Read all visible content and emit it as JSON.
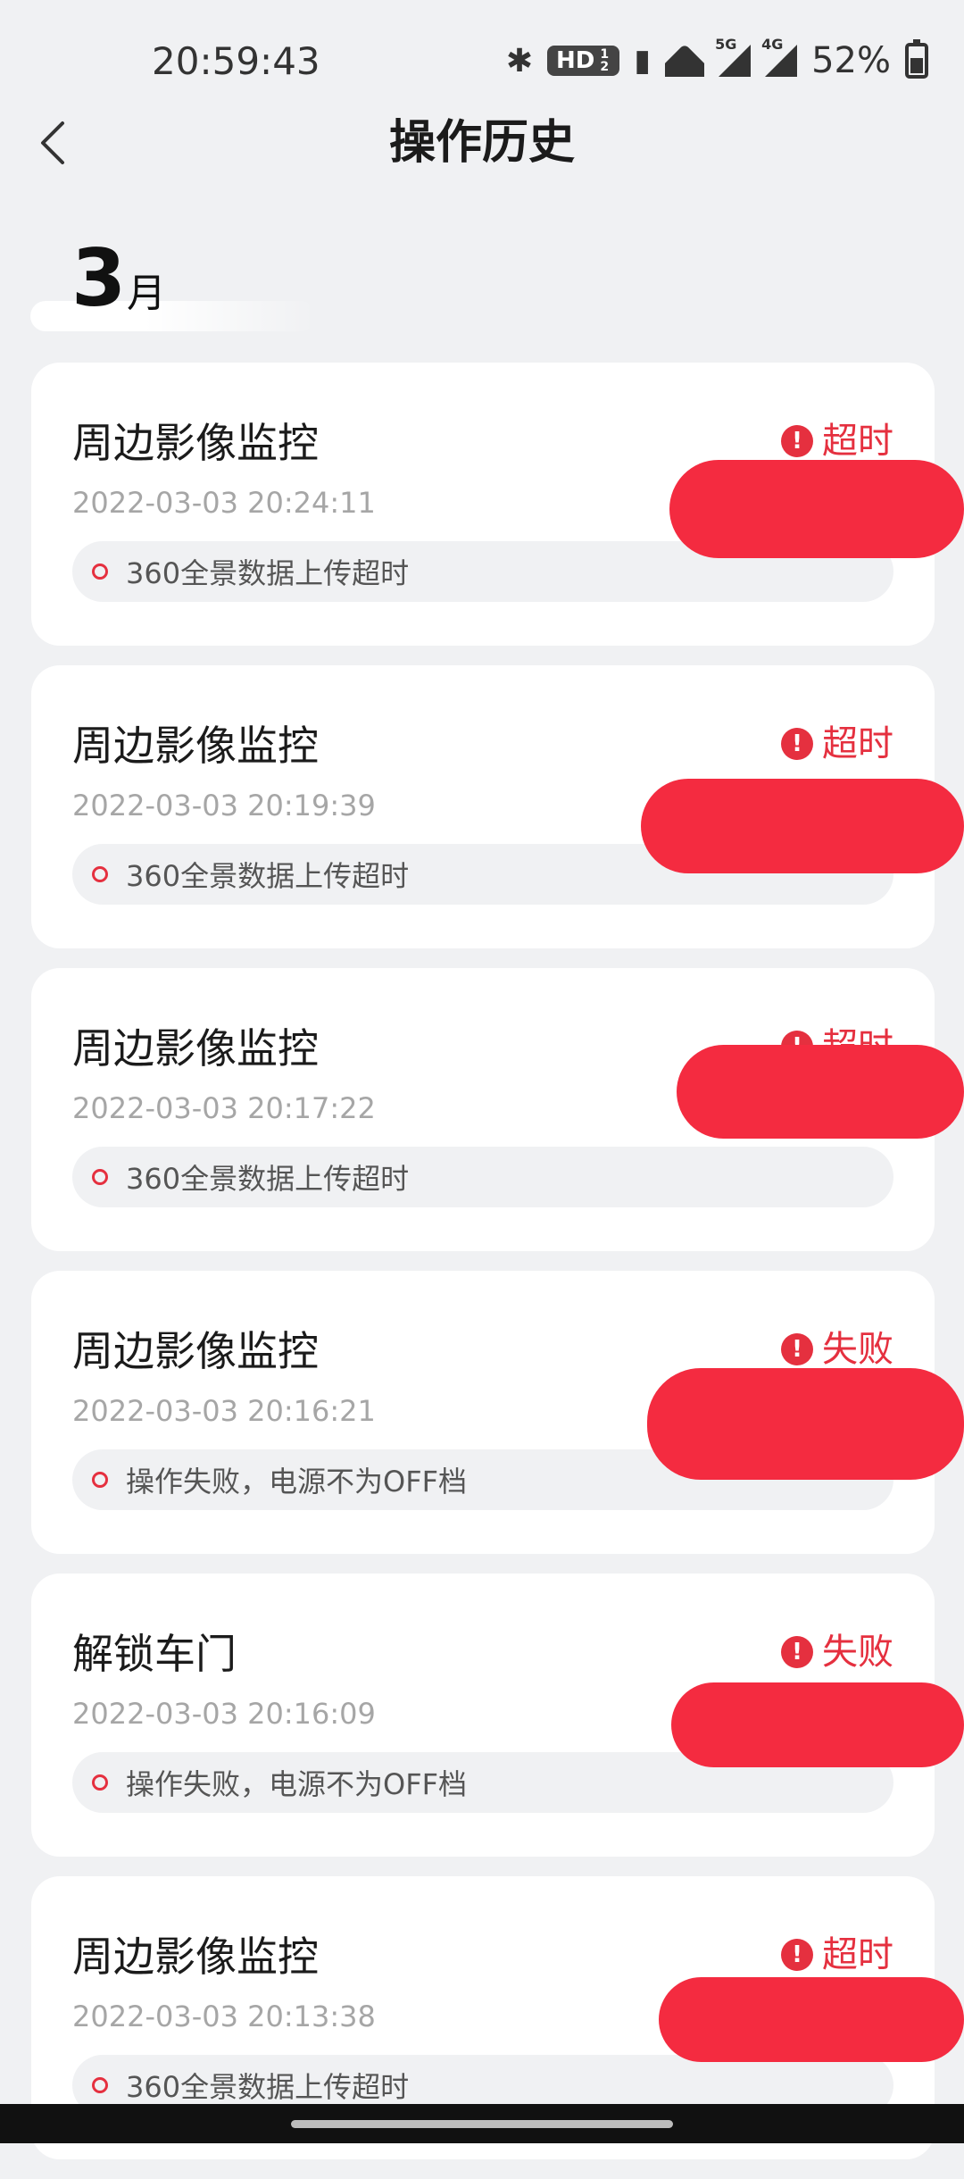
{
  "status_bar": {
    "time": "20:59:43",
    "hd": "HD",
    "hd_sub": "1 2",
    "signal_1_gen": "5G",
    "signal_2_gen": "4G",
    "battery": "52%"
  },
  "header": {
    "title": "操作历史"
  },
  "month": {
    "number": "3",
    "unit": "月"
  },
  "records": [
    {
      "title": "周边影像监控",
      "time": "2022-03-03 20:24:11",
      "status": "超时",
      "detail": "360全景数据上传超时"
    },
    {
      "title": "周边影像监控",
      "time": "2022-03-03 20:19:39",
      "status": "超时",
      "detail": "360全景数据上传超时"
    },
    {
      "title": "周边影像监控",
      "time": "2022-03-03 20:17:22",
      "status": "超时",
      "detail": "360全景数据上传超时"
    },
    {
      "title": "周边影像监控",
      "time": "2022-03-03 20:16:21",
      "status": "失败",
      "detail": "操作失败，电源不为OFF档"
    },
    {
      "title": "解锁车门",
      "time": "2022-03-03 20:16:09",
      "status": "失败",
      "detail": "操作失败，电源不为OFF档"
    },
    {
      "title": "周边影像监控",
      "time": "2022-03-03 20:13:38",
      "status": "超时",
      "detail": "360全景数据上传超时"
    }
  ],
  "colors": {
    "accent": "#e5303f",
    "background": "#f0f1f3",
    "card": "#ffffff"
  }
}
